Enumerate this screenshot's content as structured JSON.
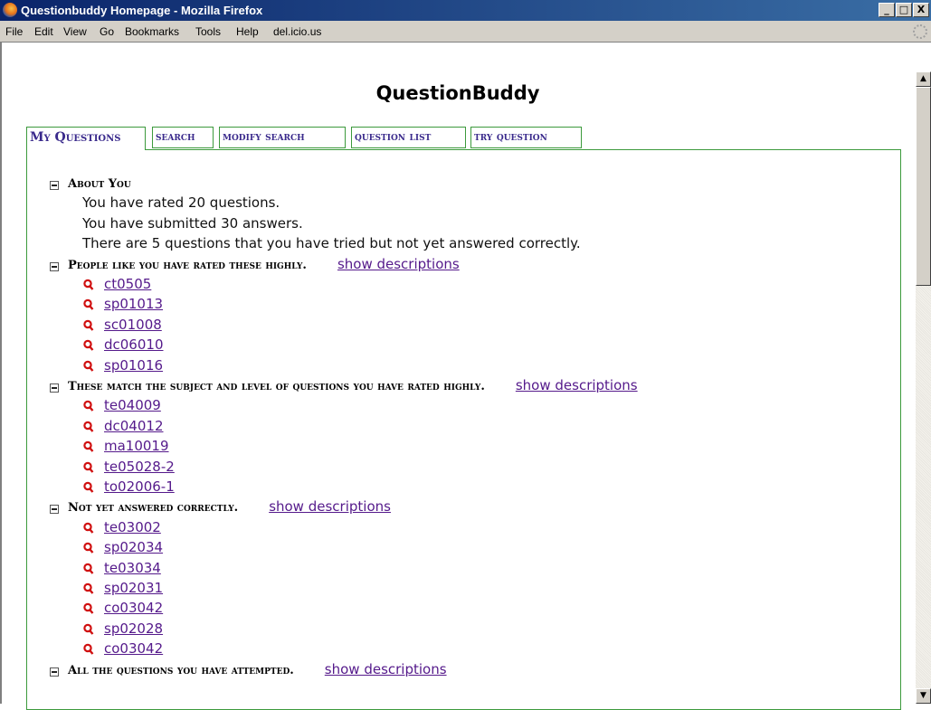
{
  "window": {
    "title": "Questionbuddy Homepage - Mozilla Firefox",
    "buttons": [
      "_",
      "□",
      "X"
    ]
  },
  "menu": [
    "File",
    "Edit",
    "View",
    "Go",
    "Bookmarks",
    "Tools",
    "Help",
    "del.icio.us"
  ],
  "page": {
    "title": "QuestionBuddy",
    "tabs": [
      "My Questions",
      "search",
      "modify search",
      "question list",
      "try question"
    ],
    "about": {
      "heading": "About You",
      "lines": [
        "You have rated 20 questions.",
        "You have submitted 30 answers.",
        "There are 5 questions that you have tried but not yet answered correctly."
      ]
    },
    "show_descriptions": "show descriptions",
    "sections": [
      {
        "heading": "People like you have rated these highly.",
        "items": [
          "ct0505",
          "sp01013",
          "sc01008",
          "dc06010",
          "sp01016"
        ]
      },
      {
        "heading": "These match the subject and level of questions you have rated highly.",
        "items": [
          "te04009",
          "dc04012",
          "ma10019",
          "te05028-2",
          "to02006-1"
        ]
      },
      {
        "heading": "Not yet answered correctly.",
        "items": [
          "te03002",
          "sp02034",
          "te03034",
          "sp02031",
          "co03042",
          "sp02028",
          "co03042"
        ]
      },
      {
        "heading": "All the questions you have attempted.",
        "items": []
      }
    ]
  },
  "colors": {
    "link": "#551a8b",
    "tab_border": "#3c9a3c",
    "tab_text": "#3a2a8c",
    "q_icon": "#d01010"
  }
}
